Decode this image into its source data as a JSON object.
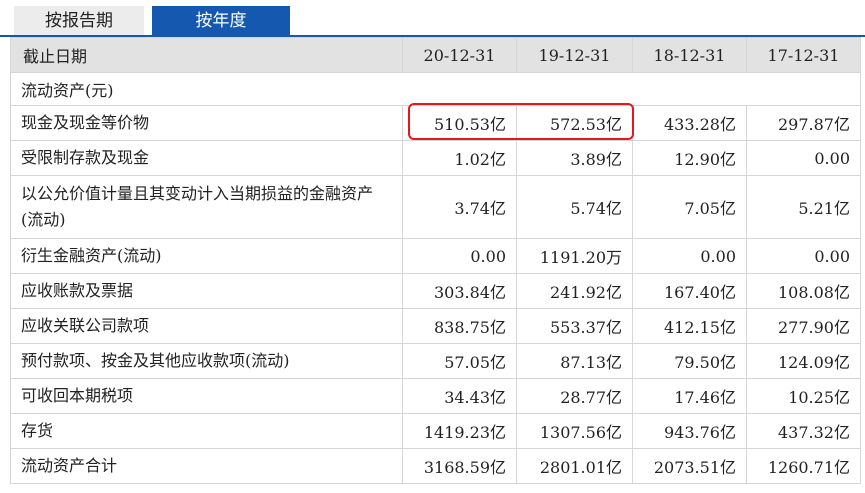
{
  "tabs": {
    "by_period": "按报告期",
    "by_year": "按年度"
  },
  "table": {
    "header_label": "截止日期",
    "columns": [
      "20-12-31",
      "19-12-31",
      "18-12-31",
      "17-12-31"
    ],
    "section_title": "流动资产(元)",
    "rows": [
      {
        "label": "现金及现金等价物",
        "values": [
          "510.53亿",
          "572.53亿",
          "433.28亿",
          "297.87亿"
        ]
      },
      {
        "label": "受限制存款及现金",
        "values": [
          "1.02亿",
          "3.89亿",
          "12.90亿",
          "0.00"
        ]
      },
      {
        "label": "以公允价值计量且其变动计入当期损益的金融资产(流动)",
        "values": [
          "3.74亿",
          "5.74亿",
          "7.05亿",
          "5.21亿"
        ]
      },
      {
        "label": "衍生金融资产(流动)",
        "values": [
          "0.00",
          "1191.20万",
          "0.00",
          "0.00"
        ]
      },
      {
        "label": "应收账款及票据",
        "values": [
          "303.84亿",
          "241.92亿",
          "167.40亿",
          "108.08亿"
        ]
      },
      {
        "label": "应收关联公司款项",
        "values": [
          "838.75亿",
          "553.37亿",
          "412.15亿",
          "277.90亿"
        ]
      },
      {
        "label": "预付款项、按金及其他应收款项(流动)",
        "values": [
          "57.05亿",
          "87.13亿",
          "79.50亿",
          "124.09亿"
        ]
      },
      {
        "label": "可收回本期税项",
        "values": [
          "34.43亿",
          "28.77亿",
          "17.46亿",
          "10.25亿"
        ]
      },
      {
        "label": "存货",
        "values": [
          "1419.23亿",
          "1307.56亿",
          "943.76亿",
          "437.32亿"
        ]
      },
      {
        "label": "流动资产合计",
        "values": [
          "3168.59亿",
          "2801.01亿",
          "2073.51亿",
          "1260.71亿"
        ]
      }
    ]
  },
  "colors": {
    "tab_active": "#1558b0",
    "tab_inactive": "#ececec",
    "header_bg": "#e2e2e2",
    "highlight": "#e3171c"
  }
}
